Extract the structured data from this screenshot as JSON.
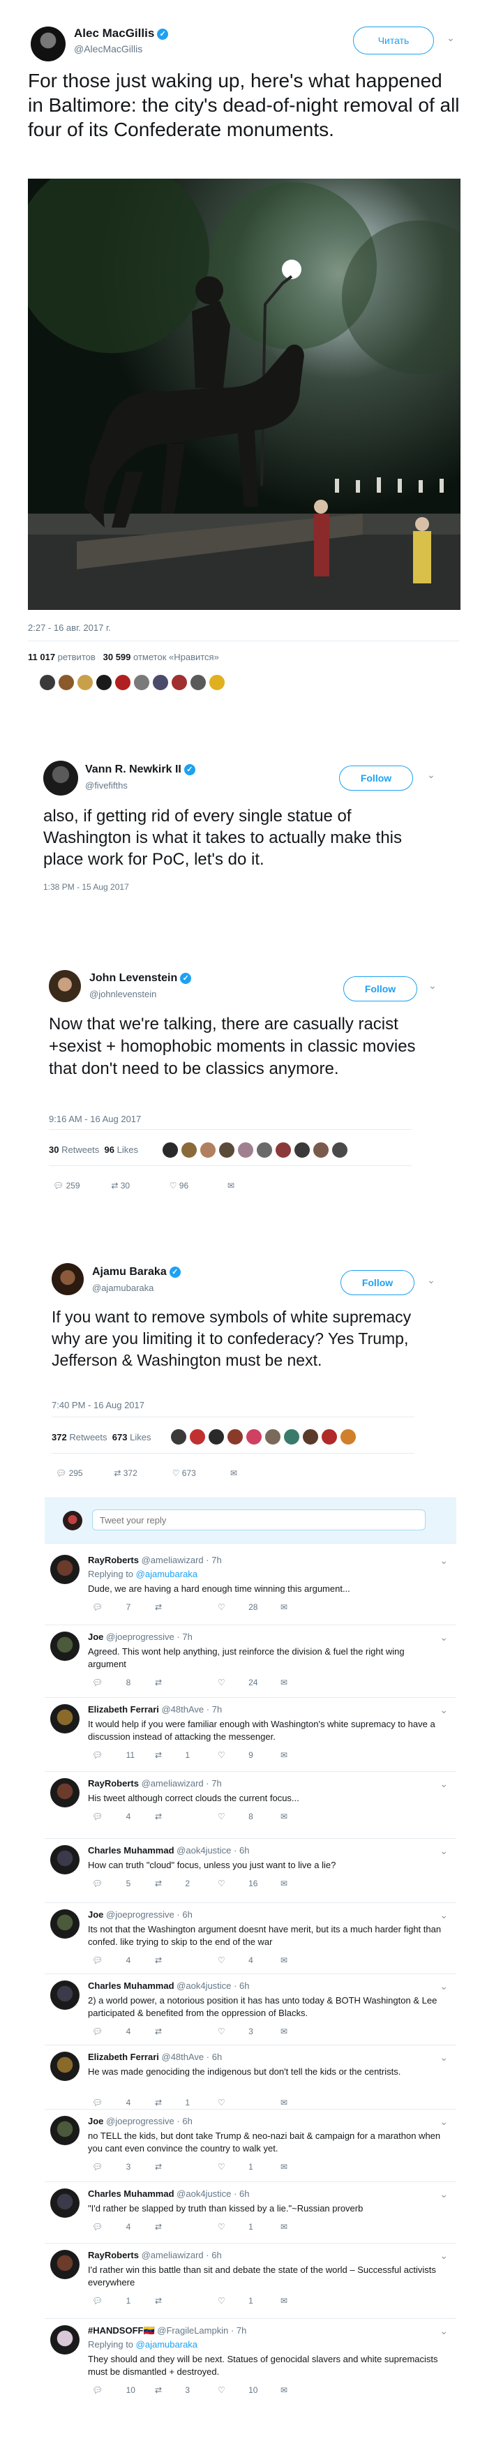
{
  "tweet1": {
    "name": "Alec MacGillis",
    "handle": "@AlecMacGillis",
    "follow_label": "Читать",
    "text": "For those just waking up, here's what happened in Baltimore: the city's dead-of-night removal of all four of its Confederate monuments.",
    "timestamp": "2:27 - 16 авг. 2017 г.",
    "retweets_count": "11 017",
    "retweets_label": "ретвитов",
    "likes_count": "30 599",
    "likes_label": "отметок «Нравится»"
  },
  "tweet2": {
    "name": "Vann R. Newkirk II",
    "handle": "@fivefifths",
    "follow_label": "Follow",
    "text": "also, if getting rid of every single statue of Washington is what it takes to actually make this place work for PoC, let's do it.",
    "timestamp": "1:38 PM - 15 Aug 2017"
  },
  "tweet3": {
    "name": "John Levenstein",
    "handle": "@johnlevenstein",
    "follow_label": "Follow",
    "text": "Now that we're talking, there are casually racist +sexist + homophobic moments in classic movies that don't need to be classics anymore.",
    "timestamp": "9:16 AM - 16 Aug 2017",
    "retweets_count": "30",
    "retweets_label": "Retweets",
    "likes_count": "96",
    "likes_label": "Likes",
    "reply_count": "259",
    "retweet_count_action": "30",
    "like_count_action": "96"
  },
  "tweet4": {
    "name": "Ajamu Baraka",
    "handle": "@ajamubaraka",
    "follow_label": "Follow",
    "text": "If you want to remove symbols of white supremacy why are you limiting it to confederacy? Yes Trump, Jefferson & Washington must be next.",
    "timestamp": "7:40 PM - 16 Aug 2017",
    "retweets_count": "372",
    "retweets_label": "Retweets",
    "likes_count": "673",
    "likes_label": "Likes",
    "reply_count": "295",
    "retweet_count_action": "372",
    "like_count_action": "673",
    "reply_placeholder": "Tweet your reply"
  },
  "replies": [
    {
      "name": "RayRoberts",
      "handle": "@ameliawizard",
      "time": "7h",
      "replying_prefix": "Replying to",
      "replying_to": "@ajamubaraka",
      "text": "Dude, we are having a hard enough time winning this argument...",
      "replies": "7",
      "retweets": "",
      "likes": "28",
      "color": "#6b3b2b"
    },
    {
      "name": "Joe",
      "handle": "@joeprogressive",
      "time": "7h",
      "text": "Agreed. This wont help anything, just reinforce the division & fuel the right wing argument",
      "replies": "8",
      "retweets": "",
      "likes": "24",
      "color": "#4a5a3a"
    },
    {
      "name": "Elizabeth Ferrari",
      "handle": "@48thAve",
      "time": "7h",
      "text": "It would help if you were familiar enough with Washington's white supremacy to have a discussion instead of attacking the messenger.",
      "replies": "11",
      "retweets": "1",
      "likes": "9",
      "color": "#8a6a2a"
    },
    {
      "name": "RayRoberts",
      "handle": "@ameliawizard",
      "time": "7h",
      "text": "His tweet although correct clouds the current focus...",
      "replies": "4",
      "retweets": "",
      "likes": "8",
      "color": "#6b3b2b"
    },
    {
      "name": "Charles Muhammad",
      "handle": "@aok4justice",
      "time": "6h",
      "text": "How can truth \"cloud\" focus, unless you just want to live a lie?",
      "replies": "5",
      "retweets": "2",
      "likes": "16",
      "color": "#3a3a4a"
    },
    {
      "name": "Joe",
      "handle": "@joeprogressive",
      "time": "6h",
      "text": "Its not that the Washington argument doesnt have merit, but its a much harder fight than confed. like trying to skip to the end of the war",
      "replies": "4",
      "retweets": "",
      "likes": "4",
      "color": "#4a5a3a"
    },
    {
      "name": "Charles Muhammad",
      "handle": "@aok4justice",
      "time": "6h",
      "text": "2) a world power, a notorious position it has has unto today & BOTH Washington & Lee participated & benefited from the oppression of Blacks.",
      "replies": "4",
      "retweets": "",
      "likes": "3",
      "color": "#3a3a4a"
    },
    {
      "name": "Elizabeth Ferrari",
      "handle": "@48thAve",
      "time": "6h",
      "text": "He was made genociding the indigenous but don't tell the kids or the centrists.",
      "replies": "4",
      "retweets": "1",
      "likes": "",
      "color": "#8a6a2a"
    },
    {
      "name": "Joe",
      "handle": "@joeprogressive",
      "time": "6h",
      "text": "no TELL the kids, but dont take Trump & neo-nazi bait & campaign for a marathon when you cant even convince the country to walk yet.",
      "replies": "3",
      "retweets": "",
      "likes": "1",
      "color": "#4a5a3a"
    },
    {
      "name": "Charles Muhammad",
      "handle": "@aok4justice",
      "time": "6h",
      "text": "\"I'd rather be slapped by truth than  kissed by a lie.\"~Russian proverb",
      "replies": "4",
      "retweets": "",
      "likes": "1",
      "color": "#3a3a4a"
    },
    {
      "name": "RayRoberts",
      "handle": "@ameliawizard",
      "time": "6h",
      "text": "I'd rather win this battle than sit and debate the state of the world – Successful activists everywhere",
      "replies": "1",
      "retweets": "",
      "likes": "1",
      "color": "#6b3b2b"
    },
    {
      "name": "#HANDSOFF🇻🇪",
      "handle": "@FragileLampkin",
      "time": "7h",
      "replying_prefix": "Replying to",
      "replying_to": "@ajamubaraka",
      "text": "They should and they will be next. Statues of genocidal slavers and white supremacists must be dismantled + destroyed.",
      "replies": "10",
      "retweets": "3",
      "likes": "10",
      "color": "#d8c8d8"
    }
  ],
  "colors": {
    "accent": "#1da1f2",
    "muted": "#657786",
    "text": "#14171a"
  }
}
